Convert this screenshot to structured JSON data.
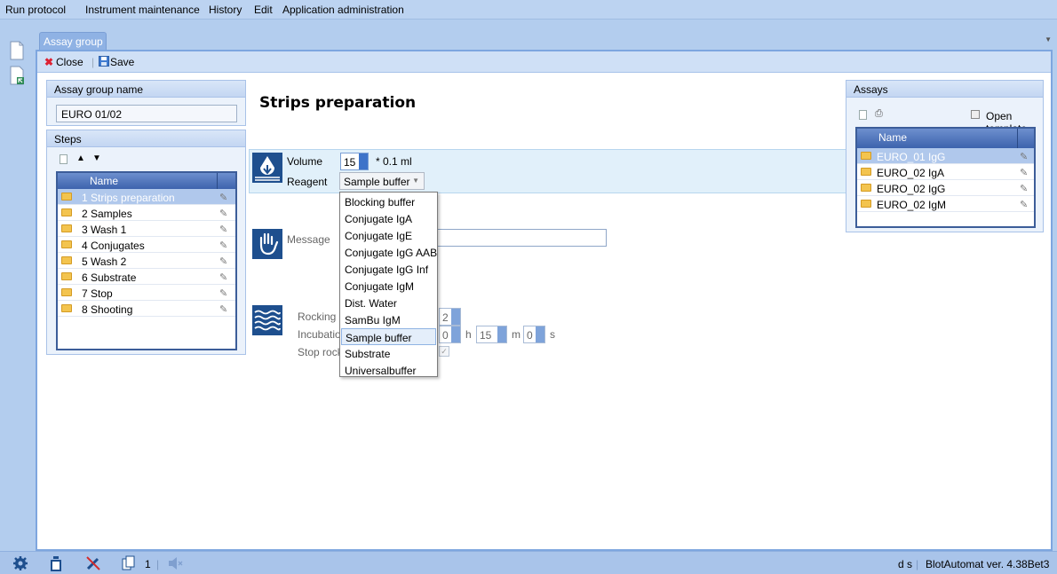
{
  "menu": [
    "Run protocol",
    "Instrument maintenance",
    "History",
    "Edit",
    "Application administration"
  ],
  "tab": {
    "label": "Assay group"
  },
  "toolbar": {
    "close_label": "Close",
    "save_label": "Save"
  },
  "assay_group_panel": {
    "title": "Assay group name",
    "value": "EURO 01/02"
  },
  "steps_panel": {
    "title": "Steps",
    "column": "Name",
    "items": [
      "1 Strips preparation",
      "2 Samples",
      "3 Wash 1",
      "4 Conjugates",
      "5 Wash 2",
      "6 Substrate",
      "7 Stop",
      "8 Shooting"
    ],
    "selected_index": 0
  },
  "main": {
    "title": "Strips preparation",
    "volume_label": "Volume",
    "volume_value": "15",
    "volume_unit": "* 0.1 ml",
    "reagent_label": "Reagent",
    "reagent_value": "Sample buffer",
    "message_label": "Message",
    "rocking_label": "Rocking s",
    "rocking_value": "2",
    "incubation_label": "Incubatio",
    "inc_h_value": "0",
    "h_unit": "h",
    "inc_m_value": "15",
    "m_unit": "m",
    "inc_s_value": "0",
    "s_unit": "s",
    "stop_label": "Stop rock"
  },
  "dropdown": {
    "options": [
      "Blocking buffer",
      "Conjugate IgA",
      "Conjugate IgE",
      "Conjugate IgG AAB",
      "Conjugate IgG Inf",
      "Conjugate IgM",
      "Dist. Water",
      "SamBu IgM",
      "Sample buffer",
      "Substrate",
      "Universalbuffer"
    ],
    "selected_index": 8
  },
  "assays_panel": {
    "title": "Assays",
    "open_template_label": "Open template",
    "column": "Name",
    "items": [
      "EURO_01 IgG",
      "EURO_02 IgA",
      "EURO_02 IgG",
      "EURO_02 IgM"
    ],
    "selected_index": 0
  },
  "status": {
    "count": "1",
    "user": "d s",
    "version": "BlotAutomat ver. 4.38Bet3"
  },
  "colors": {
    "accent": "#3d63ad",
    "selection": "#b0c8ec",
    "chrome": "#b3cdee"
  }
}
